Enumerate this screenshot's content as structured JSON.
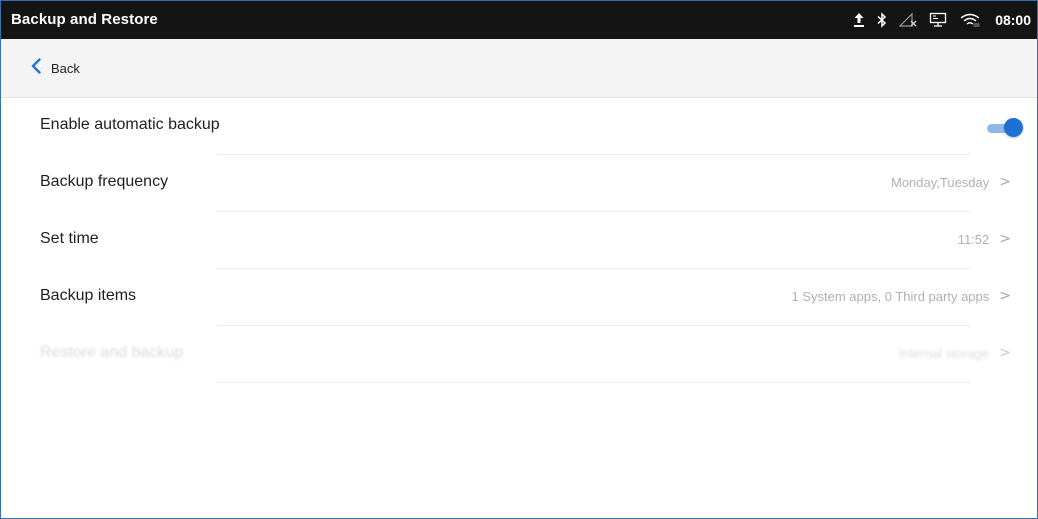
{
  "statusbar": {
    "title": "Backup and Restore",
    "time": "08:00",
    "icons": [
      "upload-icon",
      "bluetooth-icon",
      "no-network-icon",
      "screen-cast-icon",
      "wifi-icon"
    ]
  },
  "nav": {
    "back_label": "Back"
  },
  "settings": {
    "auto_backup": {
      "label": "Enable automatic backup",
      "enabled": true
    },
    "frequency": {
      "label": "Backup frequency",
      "value": "Monday,Tuesday"
    },
    "set_time": {
      "label": "Set time",
      "value": "11:52"
    },
    "backup_items": {
      "label": "Backup items",
      "value": "1  System apps, 0  Third party apps"
    },
    "disabled_item": {
      "label": "Restore and backup",
      "value": "Internal storage"
    }
  },
  "colors": {
    "accent": "#1f6fd6",
    "statusbar": "#141414"
  }
}
